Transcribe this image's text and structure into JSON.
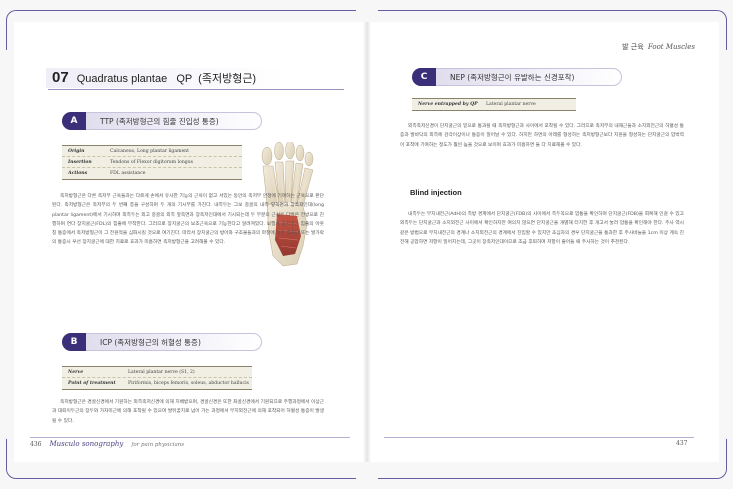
{
  "running_head": {
    "ko": "발 근육",
    "en": "Foot Muscles"
  },
  "chapter": {
    "number": "07",
    "title": "Quadratus plantae   QP  (족저방형근)"
  },
  "sections": {
    "a": {
      "badge": "A",
      "label": "TTP (족저방형근의 힘줄 진입성 통증)",
      "info": [
        {
          "key": "Origin",
          "value": "Calcaneus, Long plantar ligament"
        },
        {
          "key": "Insertion",
          "value": "Tendons of Flexor digitorum longus"
        },
        {
          "key": "Actions",
          "value": "FDL assistance"
        }
      ],
      "body": "족저방형근은 다른 족저부 근육들과는 다르게 손에서 유사한 기능의 근육이 없고 서있는 동안의 족저부 안정에 기여하는 근육으로 판단된다. 족저방형근은 족저부의 두 번째 층을 구성하며 두 개의 기시부를 가진다. 내측두는 그보 중골의 내측 앞쪽면과 장족저인대(long plantar ligament)에서 기시하며 외측두는 외고 중골의 외측 앞쪽면과 장족저인대에서 기시되는데 두 부분의 근섬유 다발은 전방으로 진행하며 연다 장지굴근(FDL)의 힘줄에 부착한다. 그러므로 장지굴근의 보조근육으로 기능한다고 알려져있다. 보행시 장지굴근 힘줄의 아웃칭 통증에서 족저방형근이 그 전원적을 심화시킬 것으로 여기진다. 따라서 장지굴근의 방어와 구조물들과의 마찰에 의한 염좌나 또는 발가락의 통증시 우선 장지굴근에 대한 치료로 효과가 미흡하면 족저방형근을 고려해볼 수 있다."
    },
    "b": {
      "badge": "B",
      "label": "ICP (족저방형근의 허혈성 통증)",
      "info": [
        {
          "key": "Nerve",
          "value": "Lateral plantar nerve (S1, 2)"
        },
        {
          "key": "Point of treatment",
          "value": "Piriformis, biceps femoris, soleus, abductor hallucis"
        }
      ],
      "body": "족저방형근은 경골신경에서 기원하는 외측족저신경에 의해 지배받으며, 경골신경은 또한 좌골신경에서 기원되므로 주행과정에서 이상근과 대퇴이두근의 장두와 가자미근에 의해 포착될 수 있으며 발뒤꿈치로 넘어 가는 과정에서 무지외전근에 의해 포착되어 허혈성 통증이 발생될 수 있다."
    },
    "c": {
      "badge": "C",
      "label": "NEP (족저방형근이 유발하는 신경포착)",
      "info": [
        {
          "key": "Nerve entrapped by QP",
          "value": "Lateral plantar nerve"
        }
      ],
      "body": "외측족저신경이 단지굴근의 밑으로 통과될 때 족저방형근과 사이에서 포착될 수 있다. 그러므로 족저부의 내재근들과 소지외전근의 허혈성 통증과 발바닥의 외측에 감각이상이나 통증이 일어날 수 있다. 하지만 하면의 아래를 형성하는 족저방형근보다 지원을 형성하는 단지굴근의 압박력이 포착에 기여하는 정도가 훨씬 높을 것으로 보이며 효과가 미흡하면 둘 다 치료해볼 수 있다."
    }
  },
  "blind_injection": {
    "title": "Blind injection",
    "body": "내측두는 무지내전근(AdH)의 측방 경계에서 단지굴근(FDB)의 사이에서 측두쪽으로 압통을 확인하며 단지굴근(FDB)을 회복해 인걸 수 있고 외측두는 단지굴근과 소지외전근 사이에서 확인하지만 여의치 않으면 단지굴근을 개별해 터치한 후 개고서 눌러 압통을 확인해야 한다. 주사 역시 같은 방법으로 무지내전근의 경계나 소지외전근의 경계에서 진입할 수 있지만 초심자의 경우 단지굴근을 통과한 후 주사바늘을 1cm 이상 계속 진전해 공압하면 저항이 일어지는데, 그곳이 장족저인대이므로 조금 후퇴하며 저항이 줄어들 때 주사하는 것이 추천된다."
  },
  "footer": {
    "left_page_number": "436",
    "series": "Musculo sonography",
    "series_sub": "for pain physicians",
    "right_page_number": "437"
  },
  "colors": {
    "accent": "#3a2f78",
    "band": "#dcd8ea",
    "frame": "#6b5aa0",
    "info_bg": "#f1efe4"
  }
}
